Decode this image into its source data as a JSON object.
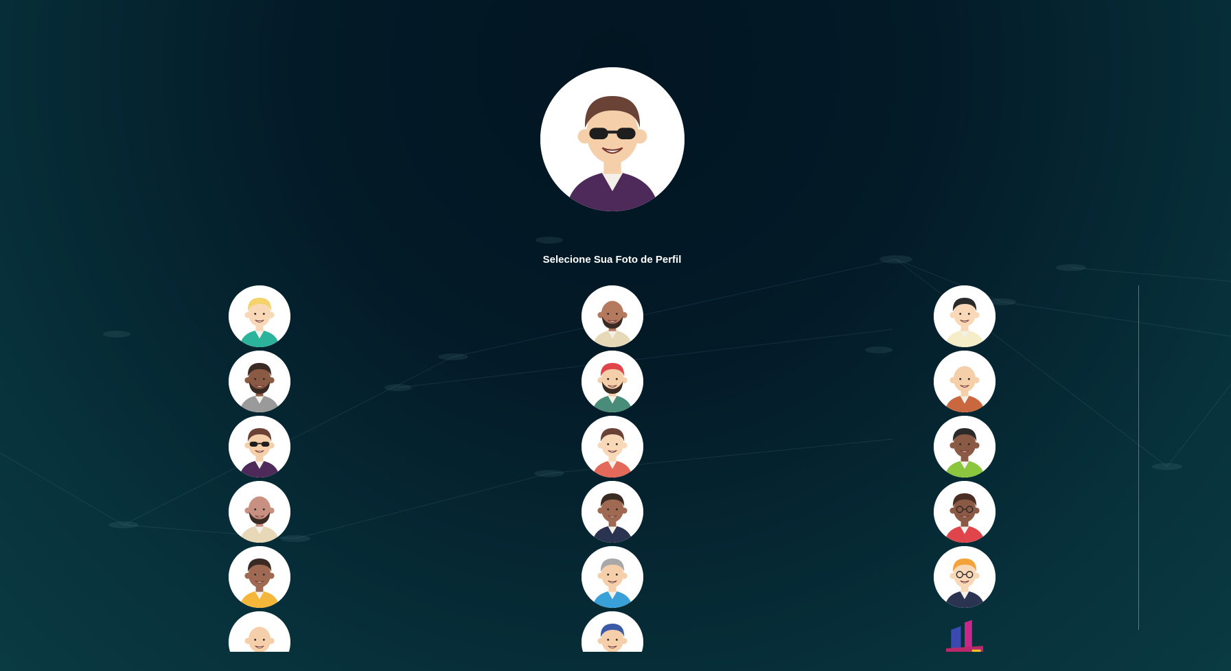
{
  "page": {
    "title": "Selecione Sua Foto de Perfil"
  },
  "selected_avatar": {
    "icon": "avatar-sunglasses-man-icon",
    "hair": "#6b4336",
    "skin": "#f5cfa9",
    "shirt": "#4d2a5a",
    "accessory": "sunglasses"
  },
  "avatars": [
    {
      "icon": "avatar-blond-man-icon",
      "hair": "#f4d36b",
      "skin": "#f9d8b8",
      "shirt": "#2bb39b",
      "accessory": "none"
    },
    {
      "icon": "avatar-bald-bearded-man-icon",
      "hair": "none",
      "skin": "#b57a5e",
      "shirt": "#e7d9b8",
      "accessory": "beard"
    },
    {
      "icon": "avatar-dark-hair-man-icon",
      "hair": "#2a2a2a",
      "skin": "#f9d8b8",
      "shirt": "#f5ecc8",
      "accessory": "none"
    },
    {
      "icon": "avatar-dreadlocks-man-icon",
      "hair": "#3a2a24",
      "skin": "#8a5a44",
      "shirt": "#9a9a9a",
      "accessory": "beard"
    },
    {
      "icon": "avatar-red-hair-man-icon",
      "hair": "#e0454b",
      "skin": "#f5cfa9",
      "shirt": "#4a8c7a",
      "accessory": "beard"
    },
    {
      "icon": "avatar-bald-old-man-icon",
      "hair": "none",
      "skin": "#f5cfa9",
      "shirt": "#c9683f",
      "accessory": "none"
    },
    {
      "icon": "avatar-sunglasses-man-icon",
      "hair": "#6b4336",
      "skin": "#f5cfa9",
      "shirt": "#4d2a5a",
      "accessory": "sunglasses"
    },
    {
      "icon": "avatar-suspenders-man-icon",
      "hair": "#6b4336",
      "skin": "#f9d8b8",
      "shirt": "#e36a5a",
      "accessory": "none"
    },
    {
      "icon": "avatar-green-jacket-man-icon",
      "hair": "#2a2a2a",
      "skin": "#8a5a44",
      "shirt": "#8cc63f",
      "accessory": "none"
    },
    {
      "icon": "avatar-bald-beard-man-icon",
      "hair": "none",
      "skin": "#c89080",
      "shirt": "#e7d9b8",
      "accessory": "beard"
    },
    {
      "icon": "avatar-curly-hair-man-icon",
      "hair": "#3a2a24",
      "skin": "#a06a52",
      "shirt": "#2a3450",
      "accessory": "none"
    },
    {
      "icon": "avatar-glasses-afro-man-icon",
      "hair": "#4a2e24",
      "skin": "#8a5a44",
      "shirt": "#e0454b",
      "accessory": "glasses"
    },
    {
      "icon": "avatar-yellow-shirt-man-icon",
      "hair": "#3a2a24",
      "skin": "#a06a52",
      "shirt": "#f4b73a",
      "accessory": "none"
    },
    {
      "icon": "avatar-grey-hair-man-icon",
      "hair": "#a8a8a8",
      "skin": "#f5cfa9",
      "shirt": "#3aa0d8",
      "accessory": "none"
    },
    {
      "icon": "avatar-orange-hair-glasses-man-icon",
      "hair": "#f4a33a",
      "skin": "#f9d8b8",
      "shirt": "#2a3450",
      "accessory": "glasses"
    },
    {
      "icon": "avatar-bald-smiling-man-icon",
      "hair": "none",
      "skin": "#f5cfa9",
      "shirt": "#e7d9b8",
      "accessory": "none"
    },
    {
      "icon": "avatar-mohawk-man-icon",
      "hair": "#3a5aa8",
      "skin": "#f5cfa9",
      "shirt": "#e7d9b8",
      "accessory": "none"
    },
    {
      "icon": "brand-logo-icon",
      "hair": "logo",
      "skin": "logo",
      "shirt": "logo",
      "accessory": "logo"
    }
  ]
}
